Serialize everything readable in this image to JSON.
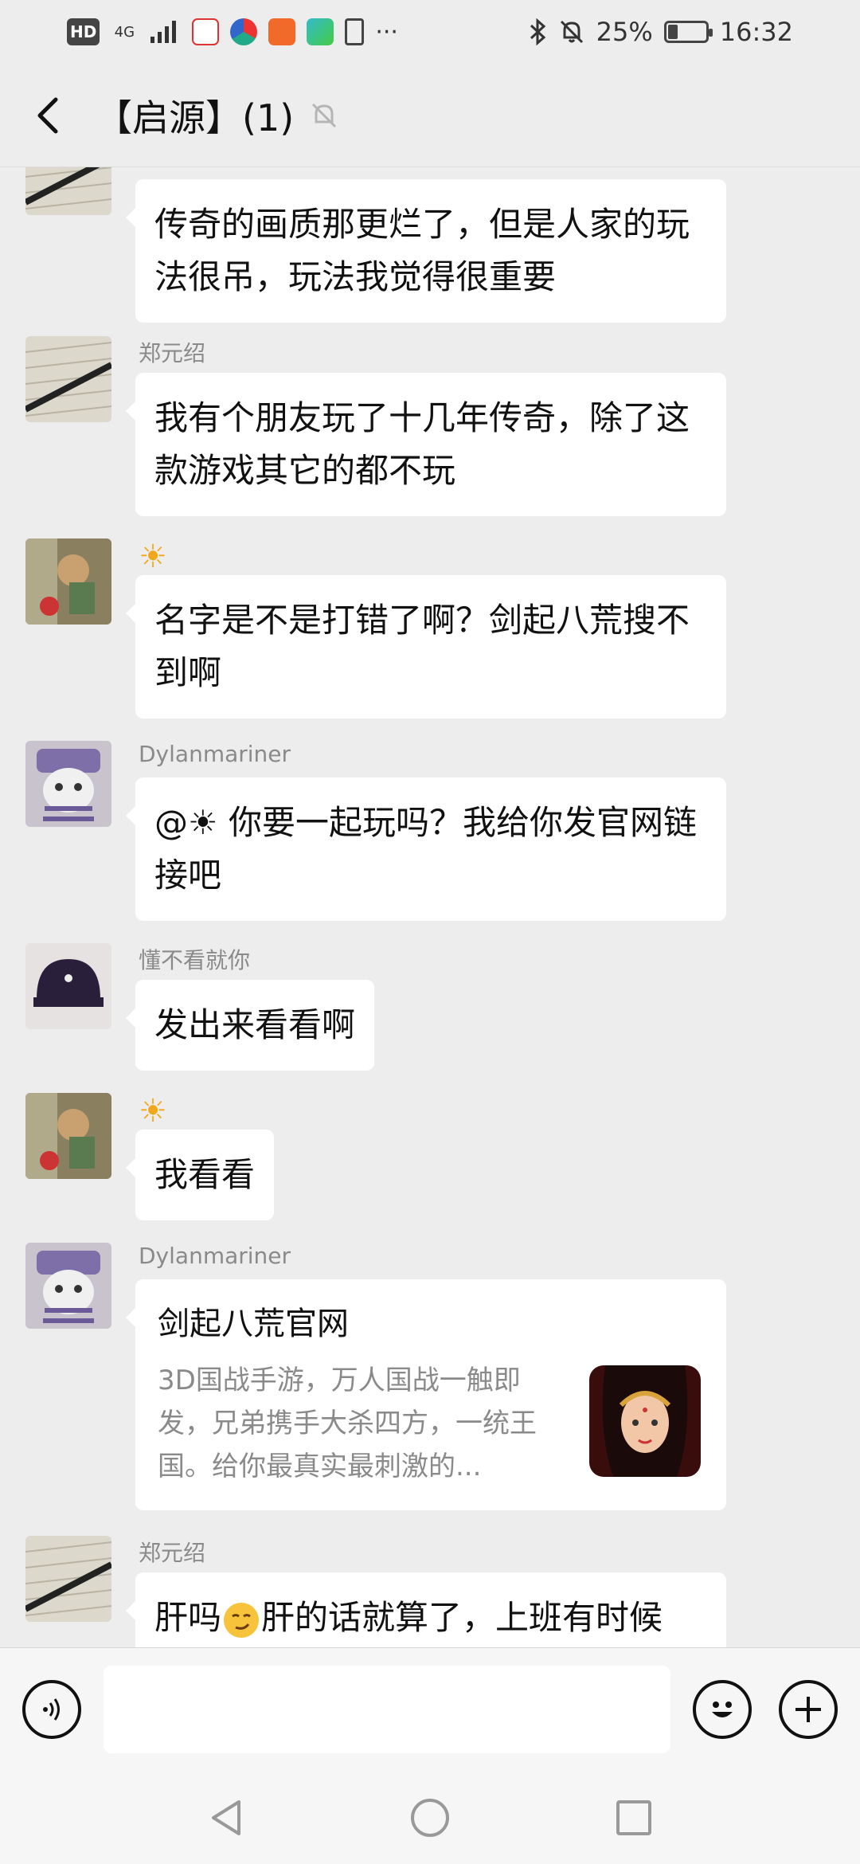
{
  "status_bar": {
    "left_badges": [
      "HD",
      "4G"
    ],
    "more": "···",
    "battery": "25%",
    "time": "16:32",
    "battery_level": 0.25
  },
  "header": {
    "title": "【启源】(1)"
  },
  "messages": [
    {
      "sender": "",
      "text": "传奇的画质那更烂了，但是人家的玩法很吊，玩法我觉得很重要",
      "avatar": "book-pen"
    },
    {
      "sender": "郑元绍",
      "text": "我有个朋友玩了十几年传奇，除了这款游戏其它的都不玩",
      "avatar": "book-pen"
    },
    {
      "sender": "☀",
      "text": "名字是不是打错了啊？剑起八荒搜不到啊",
      "avatar": "cat-girl"
    },
    {
      "sender": "Dylanmariner",
      "text": "@☀ 你要一起玩吗？我给你发官网链接吧",
      "avatar": "cat-hat"
    },
    {
      "sender": "懂不看就你",
      "text": "发出来看看啊",
      "avatar": "cap"
    },
    {
      "sender": "☀",
      "text": "我看看",
      "avatar": "cat-girl"
    },
    {
      "sender": "Dylanmariner",
      "card": {
        "title": "剑起八荒官网",
        "desc": "3D国战手游，万人国战一触即发，兄弟携手大杀四方，一统王国。给你最真实最刺激的..."
      },
      "avatar": "cat-hat"
    },
    {
      "sender": "郑元绍",
      "text_before_emoji": "肝吗",
      "text_after_emoji": "肝的话就算了，上班有时候",
      "avatar": "book-pen"
    }
  ],
  "input": {
    "placeholder": ""
  },
  "colors": {
    "background": "#ededed",
    "bubble": "#ffffff",
    "sender": "#8a8a8a"
  },
  "icons": [
    "back-arrow-icon",
    "mute-bell-icon",
    "voice-icon",
    "emoji-icon",
    "plus-icon",
    "nav-back-icon",
    "nav-home-icon",
    "nav-recents-icon"
  ]
}
